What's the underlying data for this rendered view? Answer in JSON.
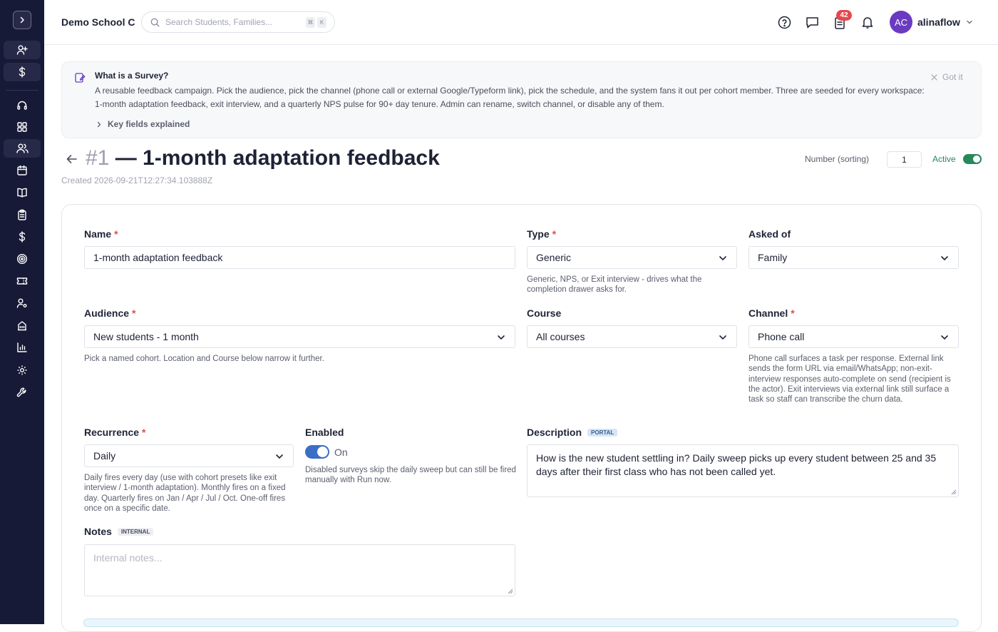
{
  "topbar": {
    "school": "Demo School C",
    "search_placeholder": "Search Students, Families...",
    "kbd1": "⌘",
    "kbd2": "K",
    "notification_count": "42",
    "avatar_initials": "AC",
    "username": "alinaflow"
  },
  "banner": {
    "title": "What is a Survey?",
    "body": "A reusable feedback campaign. Pick the audience, pick the channel (phone call or external Google/Typeform link), pick the schedule, and the system fans it out per cohort member. Three are seeded for every workspace: 1-month adaptation feedback, exit interview, and a quarterly NPS pulse for 90+ day tenure. Admin can rename, switch channel, or disable any of them.",
    "dismiss": "Got it",
    "key_fields": "Key fields explained"
  },
  "page": {
    "number": "#1",
    "title": "— 1-month adaptation feedback",
    "created": "Created 2026-09-21T12:27:34.103888Z",
    "number_label": "Number (sorting)",
    "number_value": "1",
    "active_label": "Active"
  },
  "form": {
    "name": {
      "label": "Name",
      "value": "1-month adaptation feedback"
    },
    "type": {
      "label": "Type",
      "value": "Generic",
      "help": "Generic, NPS, or Exit interview - drives what the completion drawer asks for."
    },
    "asked_of": {
      "label": "Asked of",
      "value": "Family"
    },
    "audience": {
      "label": "Audience",
      "value": "New students - 1 month",
      "help": "Pick a named cohort. Location and Course below narrow it further."
    },
    "course": {
      "label": "Course",
      "value": "All courses"
    },
    "channel": {
      "label": "Channel",
      "value": "Phone call",
      "help": "Phone call surfaces a task per response. External link sends the form URL via email/WhatsApp; non-exit-interview responses auto-complete on send (recipient is the actor). Exit interviews via external link still surface a task so staff can transcribe the churn data."
    },
    "recurrence": {
      "label": "Recurrence",
      "value": "Daily",
      "help": "Daily fires every day (use with cohort presets like exit interview / 1-month adaptation). Monthly fires on a fixed day. Quarterly fires on Jan / Apr / Jul / Oct. One-off fires once on a specific date."
    },
    "enabled": {
      "label": "Enabled",
      "state": "On",
      "help": "Disabled surveys skip the daily sweep but can still be fired manually with Run now."
    },
    "description": {
      "label": "Description",
      "tag": "PORTAL",
      "value": "How is the new student settling in? Daily sweep picks up every student between 25 and 35 days after their first class who has not been called yet."
    },
    "notes": {
      "label": "Notes",
      "tag": "INTERNAL",
      "placeholder": "Internal notes..."
    },
    "required_mark": "*"
  }
}
